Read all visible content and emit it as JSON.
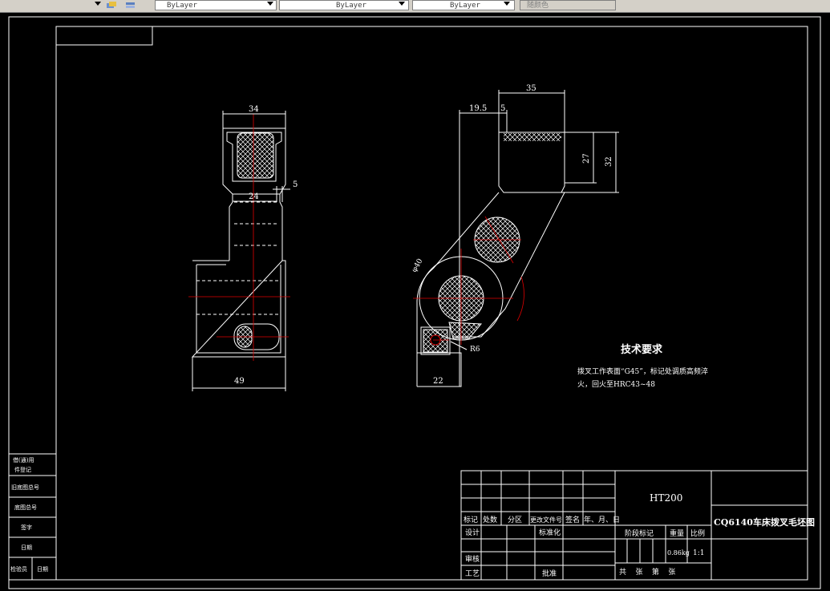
{
  "toolbar": {
    "layer1": "ByLayer",
    "layer2": "ByLayer",
    "layer3": "ByLayer",
    "color": "随颜色"
  },
  "dims": {
    "d34": "34",
    "d24": "24",
    "d5a": "5",
    "d49": "49",
    "d35": "35",
    "d19_5": "19.5",
    "d5b": "5",
    "d27": "27",
    "d32": "32",
    "d22": "22",
    "r6": "R6",
    "d40": "φ40"
  },
  "tech": {
    "title": "技术要求",
    "line1": "拨叉工作表面“G45”，标记处调质高频淬",
    "line2": "火，回火至HRC43~48"
  },
  "titleblock": {
    "material": "HT200",
    "drawing_name": "CQ6140车床拨叉毛坯图",
    "h_mark": "标记",
    "h_count": "处数",
    "h_zone": "分区",
    "h_doc": "更改文件号",
    "h_sign": "签名",
    "h_date": "年、月、日",
    "r_design": "设计",
    "r_standard": "标准化",
    "r_stage": "阶段标记",
    "r_weight": "重量",
    "r_scale": "比例",
    "weight": "0.86kg",
    "scale": "1:1",
    "r_review": "审核",
    "r_process": "工艺",
    "r_approve": "批准",
    "sheets": "共    张    第    张"
  },
  "leftblock": {
    "c1": "借(通)用",
    "c2": "件登记",
    "c3": "旧底图总号",
    "c4": "底图总号",
    "c5": "签字",
    "c6": "日期",
    "c7a": "检验员",
    "c7b": "日期"
  }
}
